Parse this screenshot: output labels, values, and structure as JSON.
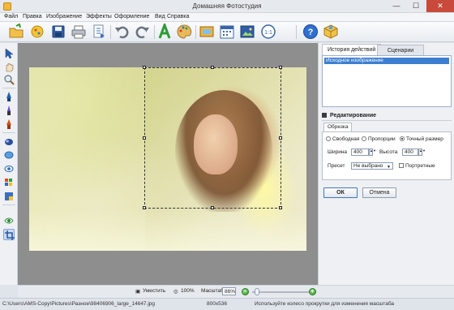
{
  "window": {
    "title": "Домашняя Фотостудия",
    "minimize": "—",
    "maximize": "☐",
    "close": "✕"
  },
  "menu": [
    "Файл",
    "Правка",
    "Изображение",
    "Эффекты",
    "Оформление",
    "Вид",
    "Справка"
  ],
  "toolbar_icons": [
    "open-icon",
    "effects-icon",
    "save-icon",
    "print-icon",
    "export-icon",
    "undo-icon",
    "redo-icon",
    "text-icon",
    "palette-icon",
    "frame-icon",
    "calendar-icon",
    "collage-icon",
    "actual-size-icon",
    "help-icon",
    "package-icon"
  ],
  "left_tools": [
    "pointer-tool",
    "hand-tool",
    "magnifier-tool",
    "pen-tool",
    "brush-tool",
    "fill-tool",
    "stamp-tool",
    "eraser-tool",
    "blur-tool",
    "sharpen-tool",
    "color-tool",
    "redeye-tool",
    "crop-tool"
  ],
  "panel": {
    "tabs": [
      "История действий",
      "Сценарии"
    ],
    "history": [
      "Исходное изображение"
    ],
    "edit_title": "Редактирование",
    "edit_subtab": "Обрезка",
    "crop_modes": [
      {
        "label": "Свободная",
        "selected": false
      },
      {
        "label": "Пропорции",
        "selected": false
      },
      {
        "label": "Точный размер",
        "selected": true
      }
    ],
    "width_label": "Ширина",
    "width_value": "400",
    "height_label": "Высота",
    "height_value": "400",
    "preset_label": "Пресет",
    "preset_value": "Не выбрано",
    "portrait_label": "Портретные",
    "portrait_checked": false,
    "ok_label": "ОК",
    "cancel_label": "Отмена"
  },
  "zoom_bar": {
    "fit_label": "Уместить",
    "actual_label": "100%",
    "scale_label": "Масштаб:",
    "scale_value": "86%",
    "zoom_level": 0.05
  },
  "status": {
    "path": "C:\\Users\\AMS-Copy\\Pictures\\Разное\\98406906_large_14647.jpg",
    "dimensions": "800x536",
    "hint": "Используйте колесо прокрутки для изменения масштаба"
  }
}
